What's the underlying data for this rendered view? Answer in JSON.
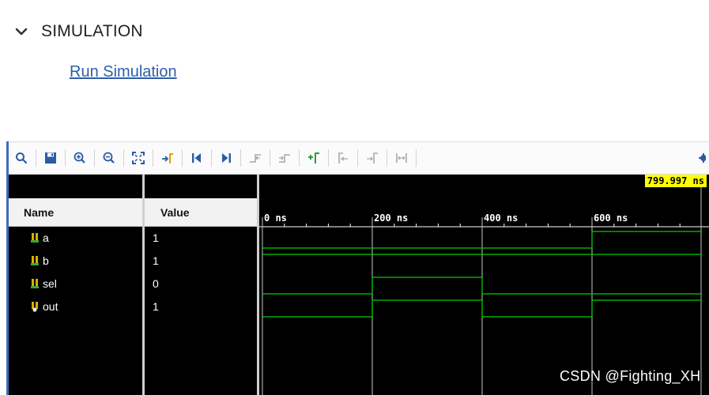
{
  "section": {
    "title": "SIMULATION",
    "chevron_icon": "chevron-down-icon",
    "run_link": "Run Simulation"
  },
  "toolbar": {
    "buttons": [
      {
        "name": "search-icon",
        "group": 0
      },
      {
        "name": "save-icon",
        "group": 1
      },
      {
        "name": "zoom-in-icon",
        "group": 2
      },
      {
        "name": "zoom-out-icon",
        "group": 3
      },
      {
        "name": "zoom-fit-icon",
        "group": 4
      },
      {
        "name": "go-to-cursor-icon",
        "group": 5
      },
      {
        "name": "go-to-time-zero-icon",
        "group": 6
      },
      {
        "name": "go-to-last-time-icon",
        "group": 7
      },
      {
        "name": "previous-transition-icon",
        "group": 8
      },
      {
        "name": "next-transition-icon",
        "group": 9
      },
      {
        "name": "add-marker-icon",
        "group": 10
      },
      {
        "name": "previous-marker-icon",
        "group": 11
      },
      {
        "name": "next-marker-icon",
        "group": 12
      },
      {
        "name": "swap-cursors-icon",
        "group": 13
      }
    ],
    "settings_icon": "gear-icon",
    "accent": "#2b5ba6",
    "disabled": "#a9a9a9",
    "add_green": "#2e9b3b"
  },
  "columns": {
    "name": "Name",
    "value": "Value"
  },
  "signals": [
    {
      "name": "a",
      "value": "1",
      "kind": "input-icon"
    },
    {
      "name": "b",
      "value": "1",
      "kind": "input-icon"
    },
    {
      "name": "sel",
      "value": "0",
      "kind": "input-icon"
    },
    {
      "name": "out",
      "value": "1",
      "kind": "output-icon"
    }
  ],
  "waveform": {
    "cursor_time": "799.997 ns",
    "time_range_ns": [
      0,
      800
    ],
    "major_ticks": [
      {
        "t": 0,
        "label": "0 ns"
      },
      {
        "t": 200,
        "label": "200 ns"
      },
      {
        "t": 400,
        "label": "400 ns"
      },
      {
        "t": 600,
        "label": "600 ns"
      }
    ],
    "minor_tick_step_ns": 40,
    "segments": {
      "a": [
        {
          "t0": 0,
          "t1": 200,
          "v": 0
        },
        {
          "t0": 200,
          "t1": 400,
          "v": 0
        },
        {
          "t0": 400,
          "t1": 600,
          "v": 0
        },
        {
          "t0": 600,
          "t1": 800,
          "v": 1
        }
      ],
      "b": [
        {
          "t0": 0,
          "t1": 200,
          "v": 1
        },
        {
          "t0": 200,
          "t1": 400,
          "v": 1
        },
        {
          "t0": 400,
          "t1": 600,
          "v": 1
        },
        {
          "t0": 600,
          "t1": 800,
          "v": 1
        }
      ],
      "sel": [
        {
          "t0": 0,
          "t1": 200,
          "v": 0
        },
        {
          "t0": 200,
          "t1": 400,
          "v": 1
        },
        {
          "t0": 400,
          "t1": 600,
          "v": 0
        },
        {
          "t0": 600,
          "t1": 800,
          "v": 0
        }
      ],
      "out": [
        {
          "t0": 0,
          "t1": 200,
          "v": 0
        },
        {
          "t0": 200,
          "t1": 400,
          "v": 1
        },
        {
          "t0": 400,
          "t1": 600,
          "v": 0
        },
        {
          "t0": 600,
          "t1": 800,
          "v": 1
        }
      ]
    },
    "trace_color": "#00d000",
    "cursor_line_color": "#c0c0c0"
  },
  "watermark": "CSDN @Fighting_XH"
}
